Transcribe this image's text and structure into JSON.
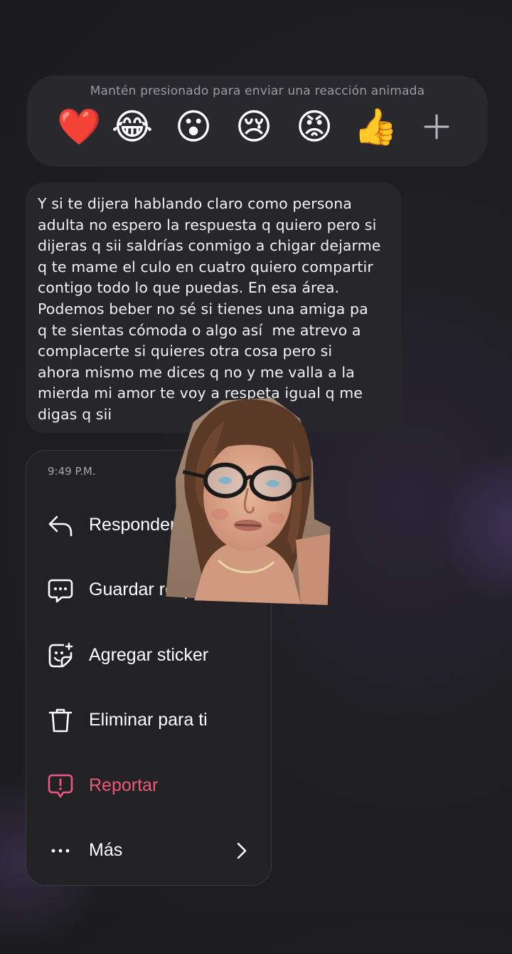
{
  "reaction_bar": {
    "hint": "Mantén presionado para enviar una reacción animada",
    "emojis": [
      "❤️",
      "😂",
      "😮",
      "😢",
      "😡",
      "👍"
    ]
  },
  "message": {
    "text": "Y si te dijera hablando claro como persona\nadulta no espero la respuesta q quiero pero si\ndijeras q sii saldrías conmigo a chigar dejarme\nq te mame el culo en cuatro quiero compartir\ncontigo todo lo que puedas. En esa área.\nPodemos beber no sé si tienes una amiga pa\nq te sientas cómoda o algo así  me atrevo a\ncomplacerte si quieres otra cosa pero si\nahora mismo me dices q no y me valla a la\nmierda mi amor te voy a respeta igual q me\ndigas q sii"
  },
  "menu": {
    "time": "9:49 P.M.",
    "items": [
      {
        "label": "Responder",
        "icon": "reply-icon"
      },
      {
        "label": "Guardar respuesta",
        "icon": "saved-reply-icon"
      },
      {
        "label": "Agregar sticker",
        "icon": "sticker-icon"
      },
      {
        "label": "Eliminar para ti",
        "icon": "trash-icon"
      },
      {
        "label": "Reportar",
        "icon": "report-icon"
      },
      {
        "label": "Más",
        "icon": "more-icon"
      }
    ]
  },
  "colors": {
    "report": "#f0577e",
    "bubble": "#27272b",
    "menu_bg": "#222225",
    "background": "#1c1c1e"
  }
}
